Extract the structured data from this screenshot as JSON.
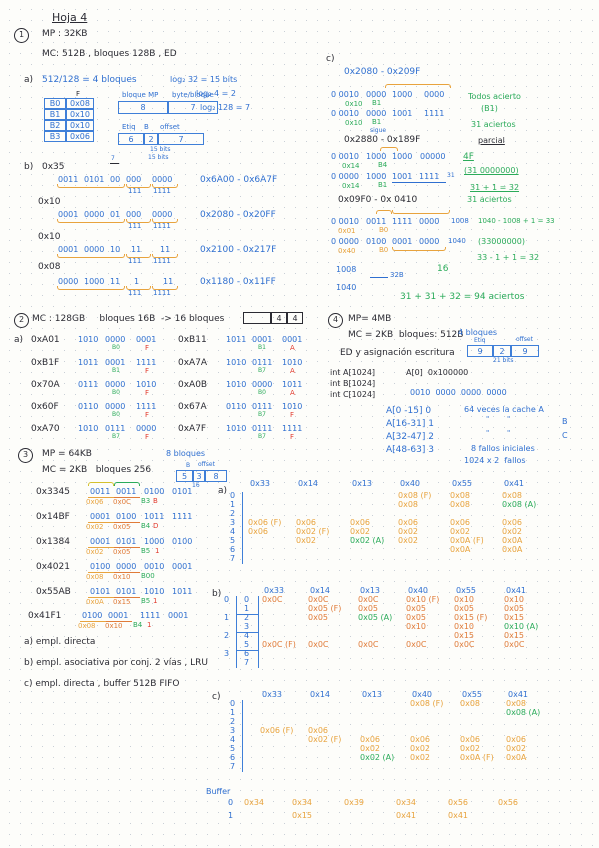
{
  "page": {
    "title": "Hoja 4"
  },
  "ex1": {
    "number": "1",
    "mp": "MP : 32KB",
    "mc": "MC: 512B , bloques 128B , ED",
    "a_label": "a)",
    "a_calc": "512/128 = 4 bloques",
    "logs": [
      "log₂ 32 = 15 bits",
      "log₂ 4 = 2",
      "log₂ 128 = 7"
    ],
    "block_table": {
      "header": "F",
      "rows": [
        {
          "name": "B0",
          "value": "0x08"
        },
        {
          "name": "B1",
          "value": "0x10"
        },
        {
          "name": "B2",
          "value": "0x10"
        },
        {
          "name": "B3",
          "value": "0x06"
        }
      ]
    },
    "fields_table1": {
      "headers": [
        "bloque MP",
        "byte/bloque"
      ],
      "values": [
        "8",
        "7"
      ]
    },
    "fields_table2": {
      "headers": [
        "Etiq",
        "B",
        "offset"
      ],
      "values": [
        "6",
        "2",
        "7"
      ],
      "footer": "15 bits"
    },
    "b_label": "b)",
    "b_rows": [
      {
        "addr": "0x35",
        "bits": [
          "0011",
          "0101",
          "00",
          "000",
          "0000"
        ],
        "sub": [
          "111",
          "1111"
        ],
        "range": "0x6A00 - 0x6A7F",
        "note_top": "7",
        "note_bits": "15 bits"
      },
      {
        "addr": "0x10",
        "bits": [
          "0001",
          "0000",
          "01",
          "000",
          "0000"
        ],
        "sub": [
          "111",
          "1111"
        ],
        "range": "0x2080 - 0x20FF"
      },
      {
        "addr": "0x10",
        "bits": [
          "0001",
          "0000",
          "10",
          "11",
          "11"
        ],
        "sub": [
          "111",
          "1111"
        ],
        "range": "0x2100 - 0x217F"
      },
      {
        "addr": "0x08",
        "bits": [
          "0000",
          "1000",
          "11",
          "1",
          "11"
        ],
        "sub": [
          "111",
          "1111"
        ],
        "range": "0x1180 - 0x11FF"
      }
    ],
    "c_label": "c)",
    "c_title": "0x2080 - 0x209F",
    "c_rows": [
      {
        "bits": [
          "0 0010",
          "0000",
          "1000",
          "0000"
        ],
        "lab1": "0x10",
        "lab2": "B1"
      },
      {
        "bits": [
          "0 0010",
          "0000",
          "1001",
          "1111"
        ],
        "lab1": "0x10",
        "lab2": "B1",
        "lab3": "sigue"
      }
    ],
    "c_note1": "Todos acierto",
    "c_note2": "(B1)",
    "c_note3": "31 aciertos",
    "c_note4": "parcial",
    "c_title2": "0x2880 - 0x189F",
    "c_rows2": [
      {
        "bits": [
          "0 0010",
          "1000",
          "1000",
          "00000"
        ],
        "lab1": "0x14",
        "lab2": "B4",
        "right": "4F"
      },
      {
        "bits": [
          "0 0000",
          "1000",
          "1001",
          "1111"
        ],
        "lab1": "0x14",
        "lab2": "B1",
        "right": "(31 0000000)",
        "sup": "31"
      }
    ],
    "c_calc1": "31 + 1 = 32",
    "c_calc2": "31 aciertos",
    "c_title3": "0x09F0 - 0x 0410",
    "c_rows3": [
      {
        "bits": [
          "0 0010",
          "0011",
          "1111",
          "0000"
        ],
        "lab1": "0x01",
        "lab2": "B0",
        "right": "1008"
      },
      {
        "bits": [
          "0 0000",
          "0100",
          "0001",
          "0000"
        ],
        "lab1": "0x40",
        "lab2": "B0",
        "right": "1040"
      }
    ],
    "c_calc3": "1040 - 1008 + 1 = 33",
    "c_calc4": "(33000000)",
    "c_calc5": "33 - 1 + 1 = 32",
    "c_calc6": "16",
    "c_left1": "1008",
    "c_left2": "1040",
    "c_left_arrow": "32B",
    "c_total": "31 + 31 + 32 = 94 aciertos"
  },
  "ex2": {
    "number": "2",
    "header": "MC : 128GB     bloques 16B  -> 16 bloques",
    "small_table": {
      "cells": [
        "",
        "4",
        "4"
      ]
    },
    "a_label": "a)",
    "left_rows": [
      {
        "addr": "0xA01",
        "b1": "1010",
        "b2": "0000",
        "b3": "0001",
        "tag": "B0",
        "f": "F"
      },
      {
        "addr": "0xB1F",
        "b1": "1011",
        "b2": "0001",
        "b3": "1111",
        "tag": "B1",
        "f": "F"
      },
      {
        "addr": "0x70A",
        "b1": "0111",
        "b2": "0000",
        "b3": "1010",
        "tag": "B0",
        "f": "F"
      },
      {
        "addr": "0x60F",
        "b1": "0110",
        "b2": "0000",
        "b3": "1111",
        "tag": "B0",
        "f": "F"
      },
      {
        "addr": "0xA70",
        "b1": "1010",
        "b2": "0111",
        "b3": "0000",
        "tag": "B7",
        "f": "F"
      }
    ],
    "right_rows": [
      {
        "addr": "0xB11",
        "b1": "1011",
        "b2": "0001",
        "b3": "0001",
        "tag": "B1",
        "f": "A"
      },
      {
        "addr": "0xA7A",
        "b1": "1010",
        "b2": "0111",
        "b3": "1010",
        "tag": "B7",
        "f": "A"
      },
      {
        "addr": "0xA0B",
        "b1": "1010",
        "b2": "0000",
        "b3": "1011",
        "tag": "B0",
        "f": "A"
      },
      {
        "addr": "0x67A",
        "b1": "0110",
        "b2": "0111",
        "b3": "1010",
        "tag": "B7",
        "f": "F"
      },
      {
        "addr": "0xA7F",
        "b1": "1010",
        "b2": "0111",
        "b3": "1111",
        "tag": "B7",
        "f": "F"
      }
    ]
  },
  "ex3": {
    "number": "3",
    "mp": "MP = 64KB",
    "mc": "MC = 2KB   bloques 256",
    "blocks_note": "8 bloques",
    "fields": {
      "headers": [
        "",
        "B",
        "offset"
      ],
      "values": [
        "5",
        "3",
        "8"
      ],
      "footer": "16"
    },
    "rows": [
      {
        "addr": "0x3345",
        "b": [
          "0011",
          "0011",
          "0100",
          "0101"
        ],
        "o1": "0x06",
        "o2": "0x0C",
        "g": "B3",
        "r": "B"
      },
      {
        "addr": "0x14BF",
        "b": [
          "0001",
          "0100",
          "1011",
          "1111"
        ],
        "o1": "0x02",
        "o2": "0x05",
        "g": "B4",
        "r": "D"
      },
      {
        "addr": "0x1384",
        "b": [
          "0001",
          "0101",
          "1000",
          "0100"
        ],
        "o1": "0x02",
        "o2": "0x05",
        "g": "B5",
        "r": "1"
      },
      {
        "addr": "0x4021",
        "b": [
          "0100",
          "0000",
          "0010",
          "0001"
        ],
        "o1": "0x08",
        "o2": "0x10",
        "g": "B00",
        "r": ""
      },
      {
        "addr": "0x55AB",
        "b": [
          "0101",
          "0101",
          "1010",
          "1011"
        ],
        "o1": "0x0A",
        "o2": "0x15",
        "g": "B5",
        "r": "1"
      },
      {
        "addr": "0x41F1",
        "b": [
          "0100",
          "0001",
          "1111",
          "0001"
        ],
        "o1": "0x08",
        "o2": "0x10",
        "g": "B4",
        "r": "1"
      }
    ],
    "questions": [
      "a) empl. directa",
      "b) empl. asociativa por conj. 2 vías , LRU",
      "c) empl. directa , buffer 512B FIFO"
    ],
    "sim_a": {
      "label": "a)",
      "columns": [
        "0x33",
        "0x14",
        "0x13",
        "0x40",
        "0x55",
        "0x41"
      ],
      "lines": [
        "0",
        "1",
        "2",
        "3",
        "4",
        "5",
        "6",
        "7"
      ],
      "cells": [
        {
          "col": 0,
          "line": 3,
          "text": "0x06 (F)",
          "color": "ora"
        },
        {
          "col": 0,
          "line": 4,
          "text": "0x06",
          "color": "ora"
        },
        {
          "col": 1,
          "line": 3,
          "text": "0x06",
          "color": "ora"
        },
        {
          "col": 1,
          "line": 4,
          "text": "0x02 (F)",
          "color": "ora"
        },
        {
          "col": 1,
          "line": 5,
          "text": "0x02",
          "color": "ora"
        },
        {
          "col": 2,
          "line": 3,
          "text": "0x06",
          "color": "ora"
        },
        {
          "col": 2,
          "line": 4,
          "text": "0x02",
          "color": "ora"
        },
        {
          "col": 2,
          "line": 5,
          "text": "0x02 (A)",
          "color": "grn"
        },
        {
          "col": 3,
          "line": 0,
          "text": "0x08 (F)",
          "color": "ora"
        },
        {
          "col": 3,
          "line": 1,
          "text": "0x08",
          "color": "ora"
        },
        {
          "col": 3,
          "line": 3,
          "text": "0x06",
          "color": "ora"
        },
        {
          "col": 3,
          "line": 4,
          "text": "0x02",
          "color": "ora"
        },
        {
          "col": 3,
          "line": 5,
          "text": "0x02",
          "color": "ora"
        },
        {
          "col": 4,
          "line": 0,
          "text": "0x08",
          "color": "ora"
        },
        {
          "col": 4,
          "line": 1,
          "text": "0x08",
          "color": "ora"
        },
        {
          "col": 4,
          "line": 3,
          "text": "0x06",
          "color": "ora"
        },
        {
          "col": 4,
          "line": 4,
          "text": "0x02",
          "color": "ora"
        },
        {
          "col": 4,
          "line": 5,
          "text": "0x0A (F)",
          "color": "ora"
        },
        {
          "col": 4,
          "line": 6,
          "text": "0x0A",
          "color": "ora"
        },
        {
          "col": 5,
          "line": 0,
          "text": "0x08",
          "color": "ora"
        },
        {
          "col": 5,
          "line": 1,
          "text": "0x08 (A)",
          "color": "grn"
        },
        {
          "col": 5,
          "line": 3,
          "text": "0x06",
          "color": "ora"
        },
        {
          "col": 5,
          "line": 4,
          "text": "0x02",
          "color": "ora"
        },
        {
          "col": 5,
          "line": 5,
          "text": "0x0A",
          "color": "ora"
        },
        {
          "col": 5,
          "line": 6,
          "text": "0x0A",
          "color": "ora"
        }
      ]
    },
    "sim_b": {
      "label": "b)",
      "columns": [
        "0x33",
        "0x14",
        "0x13",
        "0x40",
        "0x55",
        "0x41"
      ],
      "sets": [
        "0",
        "1",
        "2",
        "3"
      ],
      "lines": [
        "0",
        "1",
        "2",
        "3",
        "4",
        "5",
        "6",
        "7"
      ],
      "cells": [
        {
          "col": 0,
          "row": 0,
          "text": "0x0C",
          "color": "orl"
        },
        {
          "col": 0,
          "row": 5,
          "text": "0x0C (F)",
          "color": "orl"
        },
        {
          "col": 1,
          "row": 0,
          "text": "0x0C",
          "color": "orl"
        },
        {
          "col": 1,
          "row": 1,
          "text": "0x05 (F)",
          "color": "orl"
        },
        {
          "col": 1,
          "row": 2,
          "text": "0x05",
          "color": "orl"
        },
        {
          "col": 1,
          "row": 5,
          "text": "0x0C",
          "color": "orl"
        },
        {
          "col": 2,
          "row": 0,
          "text": "0x0C",
          "color": "orl"
        },
        {
          "col": 2,
          "row": 1,
          "text": "0x05",
          "color": "orl"
        },
        {
          "col": 2,
          "row": 2,
          "text": "0x05 (A)",
          "color": "grn"
        },
        {
          "col": 2,
          "row": 5,
          "text": "0x0C",
          "color": "orl"
        },
        {
          "col": 3,
          "row": 0,
          "text": "0x10 (F)",
          "color": "orl"
        },
        {
          "col": 3,
          "row": 1,
          "text": "0x05",
          "color": "orl"
        },
        {
          "col": 3,
          "row": 2,
          "text": "0x05",
          "color": "orl"
        },
        {
          "col": 3,
          "row": 3,
          "text": "0x10",
          "color": "orl"
        },
        {
          "col": 3,
          "row": 5,
          "text": "0x0C",
          "color": "orl"
        },
        {
          "col": 4,
          "row": 0,
          "text": "0x10",
          "color": "orl"
        },
        {
          "col": 4,
          "row": 1,
          "text": "0x05",
          "color": "orl"
        },
        {
          "col": 4,
          "row": 2,
          "text": "0x15 (F)",
          "color": "orl"
        },
        {
          "col": 4,
          "row": 3,
          "text": "0x10",
          "color": "orl"
        },
        {
          "col": 4,
          "row": 4,
          "text": "0x15",
          "color": "orl"
        },
        {
          "col": 4,
          "row": 5,
          "text": "0x0C",
          "color": "orl"
        },
        {
          "col": 5,
          "row": 0,
          "text": "0x10",
          "color": "orl"
        },
        {
          "col": 5,
          "row": 1,
          "text": "0x05",
          "color": "orl"
        },
        {
          "col": 5,
          "row": 2,
          "text": "0x15",
          "color": "orl"
        },
        {
          "col": 5,
          "row": 3,
          "text": "0x10 (A)",
          "color": "grn"
        },
        {
          "col": 5,
          "row": 4,
          "text": "0x15",
          "color": "orl"
        },
        {
          "col": 5,
          "row": 5,
          "text": "0x0C",
          "color": "orl"
        }
      ]
    },
    "sim_c": {
      "label": "c)",
      "columns": [
        "0x33",
        "0x14",
        "0x13",
        "0x40",
        "0x55",
        "0x41"
      ],
      "lines": [
        "0",
        "1",
        "2",
        "3",
        "4",
        "5",
        "6",
        "7"
      ],
      "buffer_label": "Buffer",
      "buffer_lines": [
        "0",
        "1"
      ],
      "cells": [
        {
          "col": 0,
          "line": 3,
          "text": "0x06 (F)",
          "color": "ora"
        },
        {
          "col": 1,
          "line": 3,
          "text": "0x06",
          "color": "ora"
        },
        {
          "col": 1,
          "line": 4,
          "text": "0x02 (F)",
          "color": "ora"
        },
        {
          "col": 2,
          "line": 4,
          "text": "0x06",
          "color": "ora"
        },
        {
          "col": 2,
          "line": 5,
          "text": "0x02",
          "color": "ora"
        },
        {
          "col": 2,
          "line": 6,
          "text": "0x02 (A)",
          "color": "grn"
        },
        {
          "col": 3,
          "line": 0,
          "text": "0x08 (F)",
          "color": "ora"
        },
        {
          "col": 3,
          "line": 4,
          "text": "0x06",
          "color": "ora"
        },
        {
          "col": 3,
          "line": 5,
          "text": "0x02",
          "color": "ora"
        },
        {
          "col": 3,
          "line": 6,
          "text": "0x02",
          "color": "ora"
        },
        {
          "col": 4,
          "line": 0,
          "text": "0x08",
          "color": "ora"
        },
        {
          "col": 4,
          "line": 4,
          "text": "0x06",
          "color": "ora"
        },
        {
          "col": 4,
          "line": 5,
          "text": "0x02",
          "color": "ora"
        },
        {
          "col": 4,
          "line": 6,
          "text": "0x0A (F)",
          "color": "ora"
        },
        {
          "col": 5,
          "line": 0,
          "text": "0x08",
          "color": "ora"
        },
        {
          "col": 5,
          "line": 1,
          "text": "0x08 (A)",
          "color": "grn"
        },
        {
          "col": 5,
          "line": 4,
          "text": "0x06",
          "color": "ora"
        },
        {
          "col": 5,
          "line": 5,
          "text": "0x02",
          "color": "ora"
        },
        {
          "col": 5,
          "line": 6,
          "text": "0x0A",
          "color": "ora"
        }
      ],
      "buffer_cells": [
        {
          "col": 0,
          "line": 0,
          "text": "0x34",
          "color": "ora"
        },
        {
          "col": 1,
          "line": 0,
          "text": "0x34",
          "color": "ora"
        },
        {
          "col": 1,
          "line": 1,
          "text": "0x15",
          "color": "ora"
        },
        {
          "col": 2,
          "line": 0,
          "text": "0x39",
          "color": "ora"
        },
        {
          "col": 3,
          "line": 0,
          "text": "0x34",
          "color": "ora"
        },
        {
          "col": 3,
          "line": 1,
          "text": "0x41",
          "color": "ora"
        },
        {
          "col": 4,
          "line": 0,
          "text": "0x56",
          "color": "ora"
        },
        {
          "col": 4,
          "line": 1,
          "text": "0x41",
          "color": "ora"
        },
        {
          "col": 5,
          "line": 0,
          "text": "0x56",
          "color": "ora"
        }
      ]
    }
  },
  "ex4": {
    "number": "4",
    "mp": "MP= 4MB",
    "mc": "MC = 2KB  bloques: 512B",
    "blocks_note": "4 bloques",
    "ed": "ED y asignación escritura",
    "fields": {
      "headers": [
        "Etiq",
        "",
        "offset"
      ],
      "values": [
        "9",
        "2",
        "9"
      ],
      "footer": "21 bits"
    },
    "code": [
      "int A[1024]",
      "int B[1024]",
      "int C[1024]"
    ],
    "a0": "A[0]  0x100000",
    "bits": "0010  0000  0000  0000",
    "index_rows": [
      "A[0 -15] 0",
      "A[16-31] 1",
      "A[32-47] 2",
      "A[48-63] 3"
    ],
    "note1": "64 veces la cache A",
    "note_b": "B",
    "note_c": "C",
    "note2": "8 fallos iniciales",
    "note3": "1024 x 2  fallos"
  }
}
